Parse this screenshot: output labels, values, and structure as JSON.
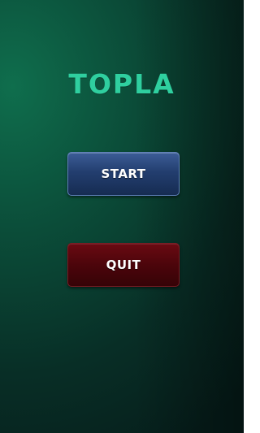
{
  "game": {
    "title": "TOPLA"
  },
  "menu": {
    "start_label": "START",
    "quit_label": "QUIT"
  },
  "colors": {
    "title": "#2fcf9f",
    "background_light": "#0f6e4d",
    "background_dark": "#061e1b",
    "start_button": "#233e6f",
    "quit_button": "#4c050b"
  }
}
